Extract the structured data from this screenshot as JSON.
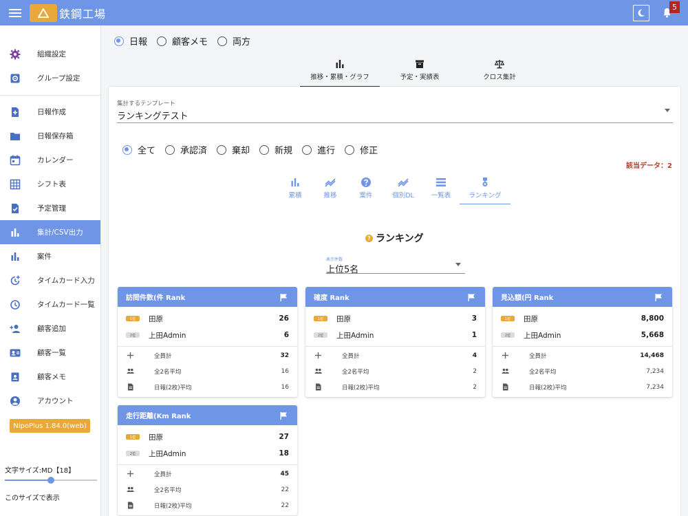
{
  "app": {
    "title": "鉄鋼工場",
    "notification_count": "5"
  },
  "sidebar": {
    "items": [
      {
        "label": "組織設定",
        "icon": "gear-icon"
      },
      {
        "label": "グループ設定",
        "icon": "group-settings-icon"
      },
      {
        "label": "日報作成",
        "icon": "add-document-icon"
      },
      {
        "label": "日報保存箱",
        "icon": "folder-icon"
      },
      {
        "label": "カレンダー",
        "icon": "calendar-icon"
      },
      {
        "label": "シフト表",
        "icon": "table-icon"
      },
      {
        "label": "予定管理",
        "icon": "task-document-icon"
      },
      {
        "label": "集計/CSV出力",
        "icon": "bar-chart-icon",
        "active": true
      },
      {
        "label": "案件",
        "icon": "bar-chart-icon"
      },
      {
        "label": "タイムカード入力",
        "icon": "clock-plus-icon"
      },
      {
        "label": "タイムカード一覧",
        "icon": "clock-icon"
      },
      {
        "label": "顧客追加",
        "icon": "person-add-icon"
      },
      {
        "label": "顧客一覧",
        "icon": "contact-card-icon"
      },
      {
        "label": "顧客メモ",
        "icon": "contact-memo-icon"
      },
      {
        "label": "アカウント",
        "icon": "account-circle-icon"
      }
    ],
    "version": "NipoPlus 1.84.0(web)",
    "font_size_label": "文字サイズ:MD【18】",
    "font_size_value": 0.5,
    "apply_size": "このサイズで表示"
  },
  "source_radios": {
    "options": [
      "日報",
      "顧客メモ",
      "両方"
    ],
    "selected": "日報"
  },
  "main_tabs": [
    {
      "label": "推移・累積・グラフ",
      "icon": "bar-chart-icon",
      "active": true
    },
    {
      "label": "予定・実績表",
      "icon": "archive-icon"
    },
    {
      "label": "クロス集計",
      "icon": "scale-icon"
    }
  ],
  "template": {
    "label": "集計するテンプレート",
    "value": "ランキングテスト"
  },
  "status_radios": {
    "options": [
      "全て",
      "承認済",
      "棄却",
      "新規",
      "進行",
      "修正"
    ],
    "selected": "全て"
  },
  "hit_count": "該当データ：2",
  "sub_tabs": [
    {
      "label": "累積",
      "icon": "bar-chart-icon"
    },
    {
      "label": "推移",
      "icon": "trend-icon"
    },
    {
      "label": "案件",
      "icon": "help-circle-icon"
    },
    {
      "label": "個別DL",
      "icon": "trend-icon"
    },
    {
      "label": "一覧表",
      "icon": "list-icon"
    },
    {
      "label": "ランキング",
      "icon": "medal-icon",
      "active": true
    }
  ],
  "ranking": {
    "title": "ランキング",
    "count_label": "表示件数",
    "count_value": "上位5名",
    "cards": [
      {
        "title": "訪問件数(件 Rank",
        "rows": [
          {
            "badge": "1位",
            "name": "田原",
            "value": "26"
          },
          {
            "badge": "2位",
            "name": "上田Admin",
            "value": "6"
          }
        ],
        "total_label": "全員計",
        "total": "32",
        "avg_label": "全2名平均",
        "avg": "16",
        "report_avg_label": "日報(2枚)平均",
        "report_avg": "16"
      },
      {
        "title": "確度 Rank",
        "rows": [
          {
            "badge": "1位",
            "name": "田原",
            "value": "3"
          },
          {
            "badge": "2位",
            "name": "上田Admin",
            "value": "1"
          }
        ],
        "total_label": "全員計",
        "total": "4",
        "avg_label": "全2名平均",
        "avg": "2",
        "report_avg_label": "日報(2枚)平均",
        "report_avg": "2"
      },
      {
        "title": "見込額(円 Rank",
        "rows": [
          {
            "badge": "1位",
            "name": "田原",
            "value": "8,800"
          },
          {
            "badge": "2位",
            "name": "上田Admin",
            "value": "5,668"
          }
        ],
        "total_label": "全員計",
        "total": "14,468",
        "avg_label": "全2名平均",
        "avg": "7,234",
        "report_avg_label": "日報(2枚)平均",
        "report_avg": "7,234"
      },
      {
        "title": "走行距離(Km Rank",
        "rows": [
          {
            "badge": "1位",
            "name": "田原",
            "value": "27"
          },
          {
            "badge": "2位",
            "name": "上田Admin",
            "value": "18"
          }
        ],
        "total_label": "全員計",
        "total": "45",
        "avg_label": "全2名平均",
        "avg": "22",
        "report_avg_label": "日報(2枚)平均",
        "report_avg": "22"
      }
    ]
  },
  "colors": {
    "primary": "#6f95e6",
    "accent": "#e8a93a",
    "danger": "#c0392b"
  }
}
